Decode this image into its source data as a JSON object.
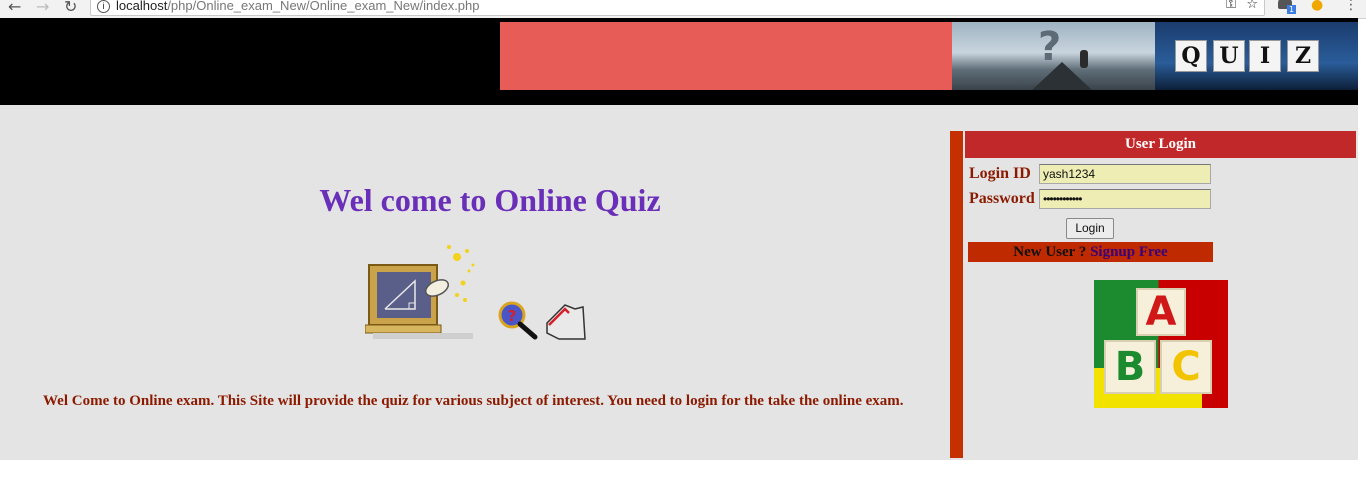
{
  "browser": {
    "url_host": "localhost",
    "url_path": "/php/Online_exam_New/Online_exam_New/index.php",
    "back_glyph": "←",
    "forward_glyph": "→",
    "reload_glyph": "↻",
    "info_glyph": "i",
    "key_glyph": "⚿",
    "star_glyph": "☆",
    "extension_badge": "1",
    "menu_glyph": "⋮"
  },
  "header": {
    "quiz_letters": [
      "Q",
      "U",
      "I",
      "Z"
    ],
    "banner_question_mark": "?"
  },
  "main": {
    "welcome_title": "Wel come to Online Quiz",
    "intro_text": "Wel Come to Online exam. This Site will provide the quiz for various subject of interest. You need to login for the take the online exam."
  },
  "login": {
    "heading": "User Login",
    "login_id_label": "Login ID",
    "login_id_value": "yash1234",
    "password_label": "Password",
    "password_value": "••••••••••••",
    "submit_label": "Login",
    "new_user_text": "New User ?",
    "signup_link_text": "Signup Free"
  },
  "abc_image": {
    "letters": [
      "A",
      "B",
      "C"
    ]
  },
  "colors": {
    "header_bg": "#000000",
    "banner_red": "#e85c57",
    "title_purple": "#6a2fb8",
    "text_dark_red": "#8b1a00",
    "login_header_red": "#c0282a",
    "sidebar_bar": "#c43000",
    "input_bg": "#eeeeb4"
  }
}
